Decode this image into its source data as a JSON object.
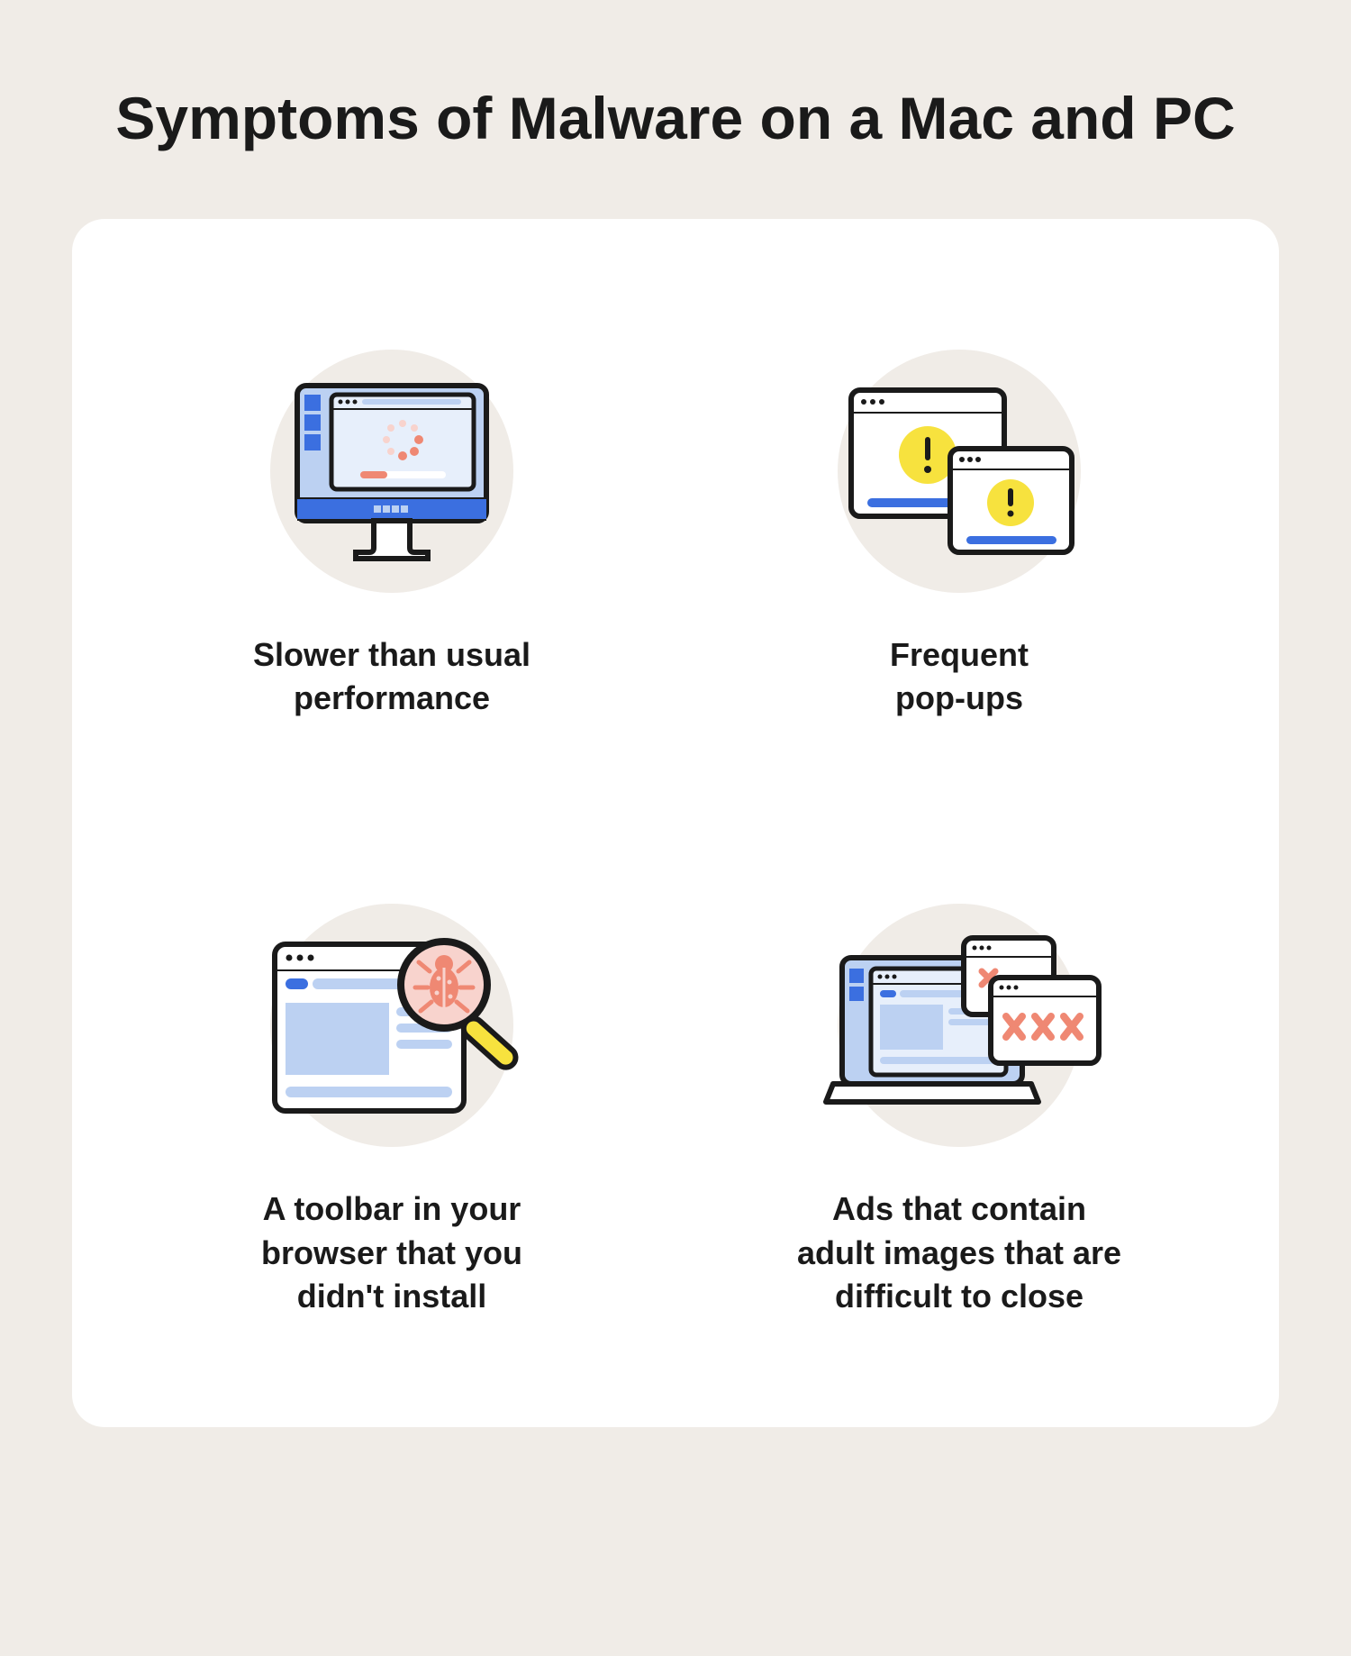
{
  "title": "Symptoms of Malware\non a Mac and PC",
  "items": [
    {
      "icon": "slow-computer-icon",
      "label": "Slower than usual\nperformance"
    },
    {
      "icon": "popups-icon",
      "label": "Frequent\npop-ups"
    },
    {
      "icon": "toolbar-bug-icon",
      "label": "A toolbar in your\nbrowser that you\ndidn't install"
    },
    {
      "icon": "adult-ads-icon",
      "label": "Ads that contain\nadult images that are\ndifficult to close"
    }
  ],
  "colors": {
    "accent_blue": "#3b6fe0",
    "light_blue": "#bcd1f2",
    "lighter_blue": "#e7effb",
    "yellow": "#f7e23e",
    "pink": "#f8d3cd",
    "salmon": "#ef8873",
    "stroke": "#1a1a1a"
  }
}
